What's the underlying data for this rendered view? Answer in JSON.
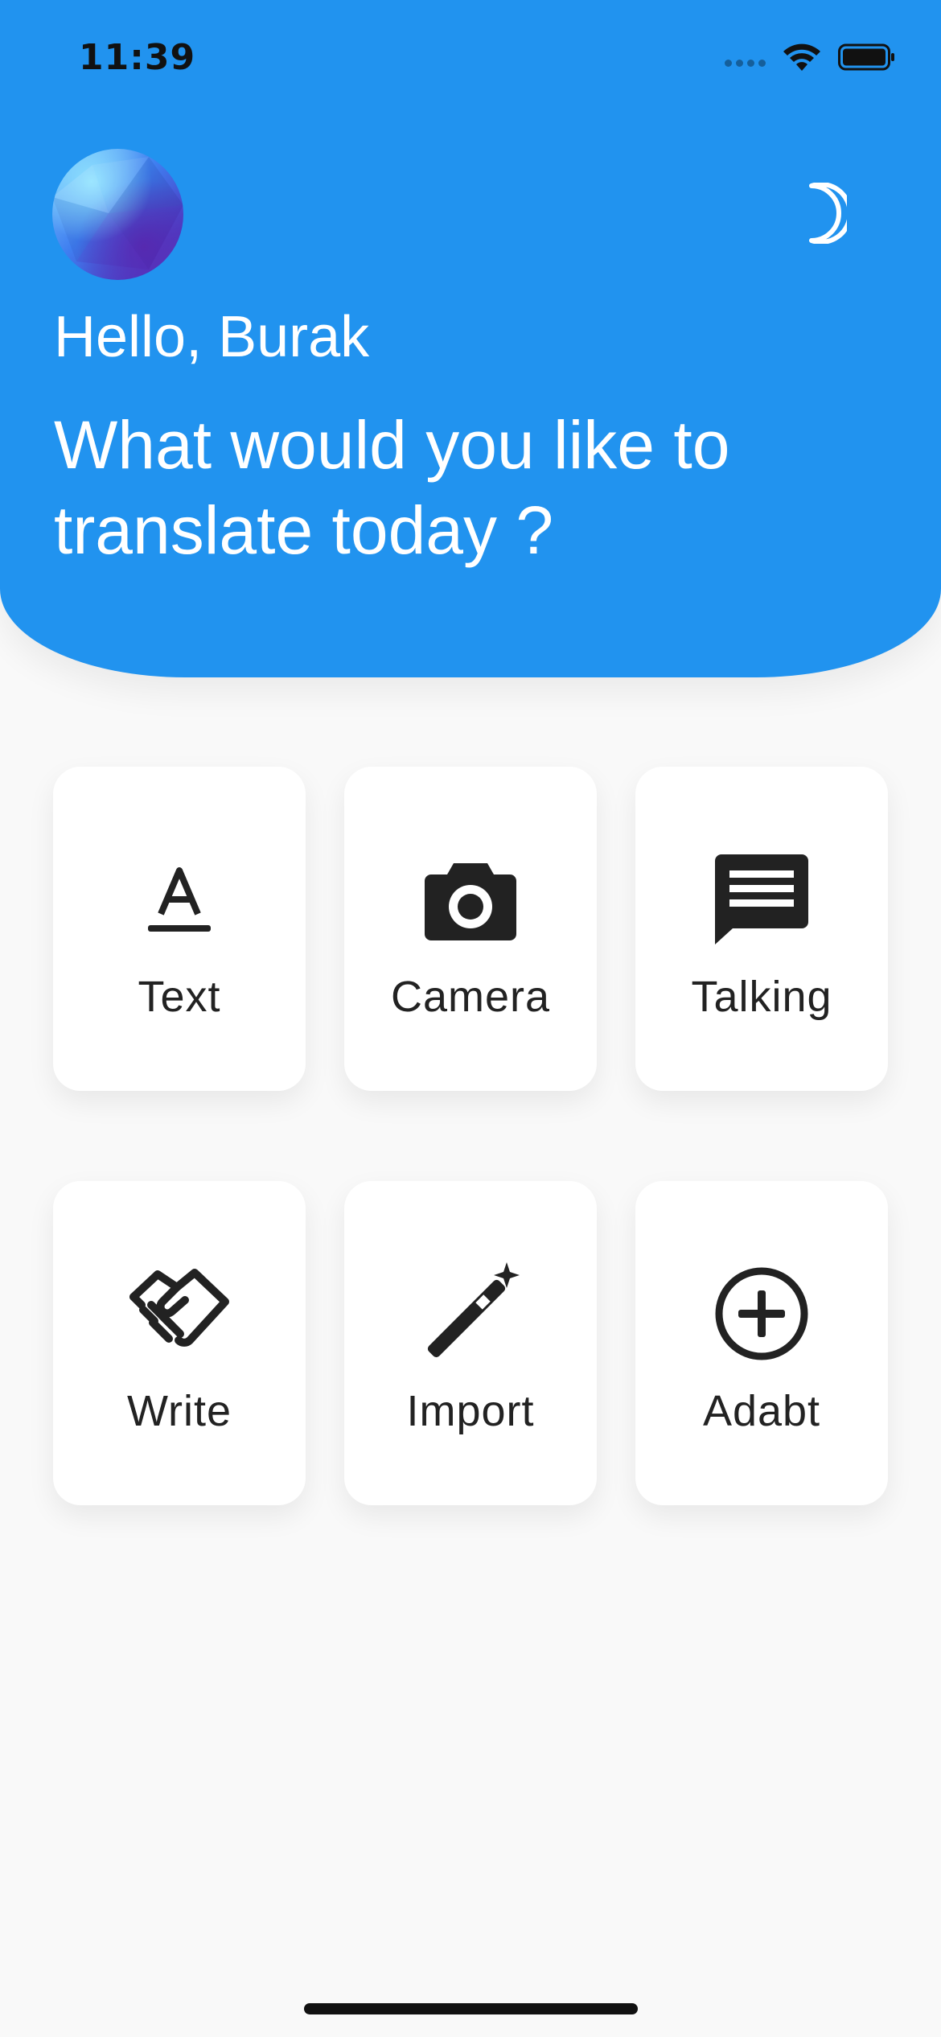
{
  "status_bar": {
    "time": "11:39"
  },
  "header": {
    "greeting": "Hello, Burak",
    "question": "What would you like to translate today ?",
    "background_color": "#2193ef",
    "theme_toggle_icon": "moon-icon"
  },
  "cards": [
    {
      "label": "Text",
      "icon": "text-format-icon"
    },
    {
      "label": "Camera",
      "icon": "camera-icon"
    },
    {
      "label": "Talking",
      "icon": "chat-bubble-icon"
    },
    {
      "label": "Write",
      "icon": "handshake-icon"
    },
    {
      "label": "Import",
      "icon": "magic-wand-icon"
    },
    {
      "label": "Adabt",
      "icon": "add-circle-icon"
    }
  ]
}
